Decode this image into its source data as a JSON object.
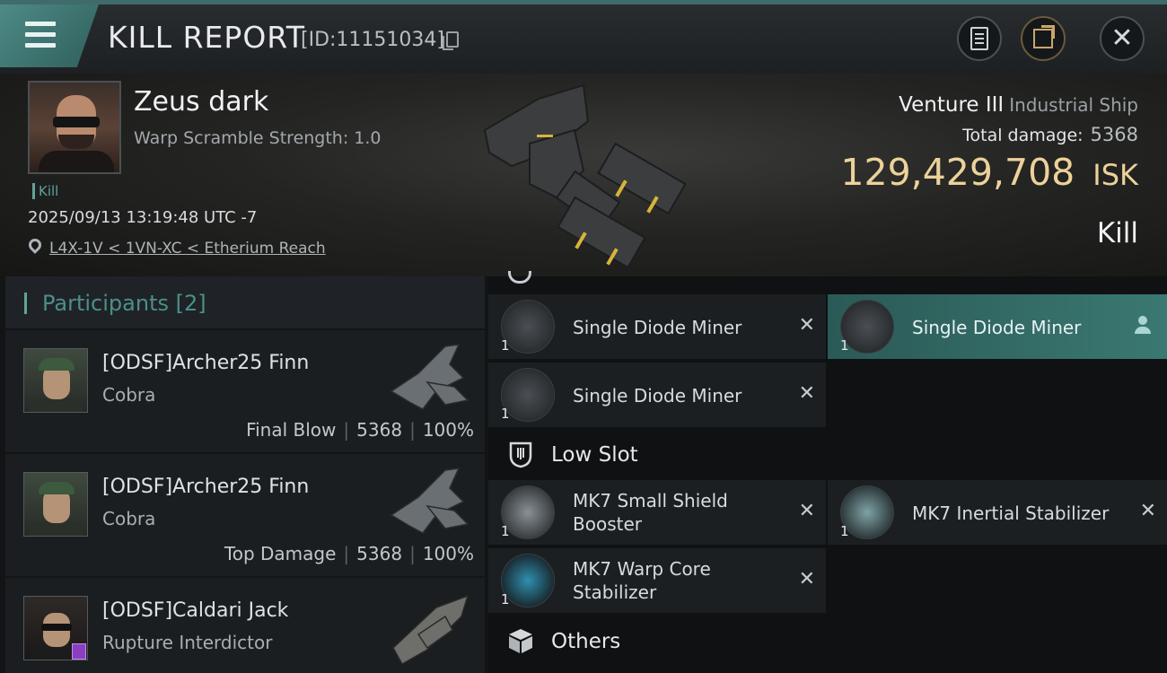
{
  "topbar": {
    "title": "KILL REPORT",
    "report_id": "[ID:11151034]"
  },
  "victim": {
    "name": "Zeus dark",
    "warp_scramble": "Warp Scramble Strength: 1.0",
    "kill_tag": "Kill",
    "datetime": "2025/09/13 13:19:48 UTC -7",
    "location": "L4X-1V < 1VN-XC < Etherium Reach",
    "ship_name": "Venture III",
    "ship_class": "Industrial Ship",
    "total_damage_label": "Total damage:",
    "total_damage_value": "5368",
    "isk_value": "129,429,708",
    "isk_unit": "ISK",
    "result_label": "Kill"
  },
  "participants": {
    "title": "Participants [2]",
    "rows": [
      {
        "name": "[ODSF]Archer25 Finn",
        "ship": "Cobra",
        "role": "Final Blow",
        "damage": "5368",
        "percent": "100%"
      },
      {
        "name": "[ODSF]Archer25 Finn",
        "ship": "Cobra",
        "role": "Top Damage",
        "damage": "5368",
        "percent": "100%"
      },
      {
        "name": "[ODSF]Caldari Jack",
        "ship": "Rupture Interdictor"
      }
    ]
  },
  "fitting": {
    "high_modules": [
      {
        "name": "Single Diode Miner",
        "qty": "1"
      },
      {
        "name": "Single Diode Miner",
        "qty": "1"
      },
      {
        "name": "Single Diode Miner",
        "qty": "1"
      }
    ],
    "low_slot_label": "Low Slot",
    "low_modules": [
      {
        "name_line1": "MK7 Small Shield",
        "name_line2": "Booster",
        "qty": "1"
      },
      {
        "name": "MK7 Inertial Stabilizer",
        "qty": "1"
      },
      {
        "name_line1": "MK7 Warp Core",
        "name_line2": "Stabilizer",
        "qty": "1"
      }
    ],
    "others_label": "Others"
  },
  "icons": {
    "menu": "hamburger-icon",
    "copy": "copy-icon",
    "notes": "clipboard-icon",
    "share": "share-icon",
    "close": "close-icon",
    "location": "map-pin-icon",
    "remove": "close-icon",
    "pilot": "pilot-icon"
  },
  "colors": {
    "accent_teal": "#4e8a86",
    "isk_gold": "#ecd29a",
    "active_module": "#3b7872"
  }
}
